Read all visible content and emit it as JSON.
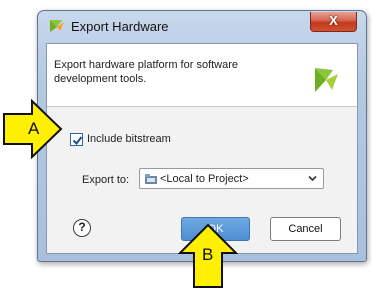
{
  "window": {
    "title": "Export Hardware",
    "close_label": "X"
  },
  "header": {
    "description": "Export hardware platform for software development tools."
  },
  "options": {
    "include_bitstream_label": "Include bitstream",
    "include_bitstream_checked": true,
    "export_to_label": "Export to:",
    "export_to_value": "<Local to Project>"
  },
  "buttons": {
    "help_label": "?",
    "ok_label": "OK",
    "cancel_label": "Cancel"
  },
  "annotations": {
    "a_label": "A",
    "b_label": "B",
    "arrow_color": "#ffef00"
  },
  "colors": {
    "ok_button": "#5193d6",
    "brand_green": "#7cb822",
    "close_red": "#c8432a"
  }
}
